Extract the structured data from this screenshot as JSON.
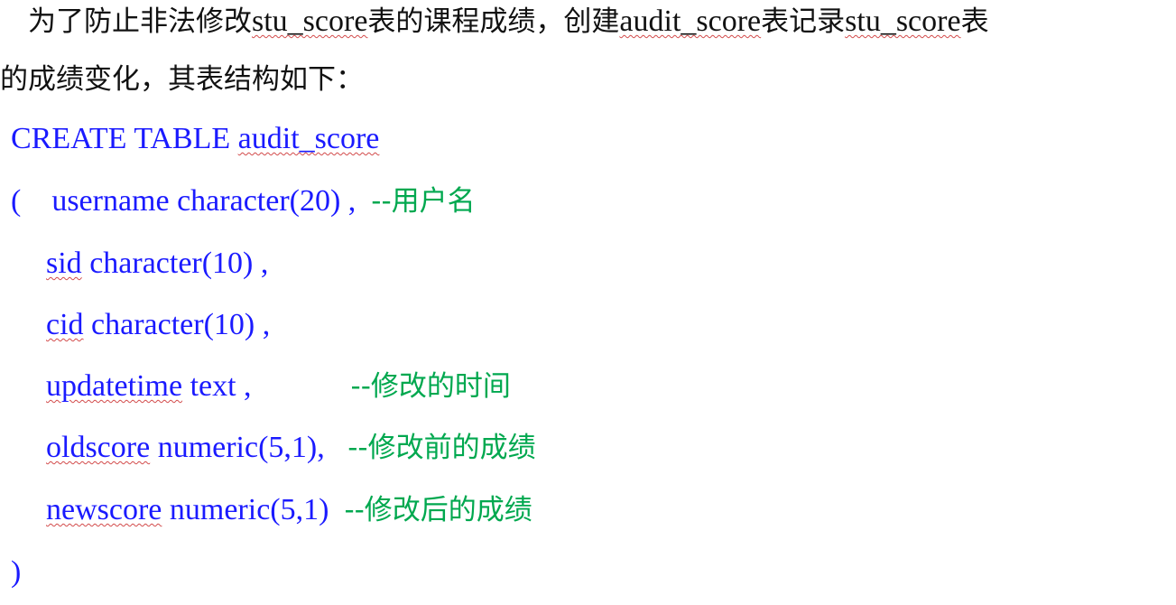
{
  "paragraph": {
    "line1": {
      "t1": "　为了防止非法修改",
      "t2": "stu_score",
      "t3": "表的课程成绩，创建",
      "t4": "audit_score",
      "t5": "表记录",
      "t6": "stu_score",
      "t7": "表"
    },
    "line2": "的成绩变化，其表结构如下："
  },
  "code": {
    "line1": {
      "kw": "CREATE TABLE ",
      "name": "audit_score"
    },
    "line2": {
      "code": "(    username character(20) ,  ",
      "comment": "--用户名"
    },
    "line3": {
      "name": "sid",
      "rest": " character(10) ,"
    },
    "line4": {
      "name": "cid",
      "rest": " character(10) ,"
    },
    "line5": {
      "name": "updatetime",
      "rest": " text ,",
      "comment": "--修改的时间"
    },
    "line6": {
      "name": "oldscore",
      "rest": " numeric(5,1),   ",
      "comment": "--修改前的成绩"
    },
    "line7": {
      "name": "newscore",
      "rest": " numeric(5,1)  ",
      "comment": "--修改后的成绩"
    },
    "line8": ")"
  }
}
